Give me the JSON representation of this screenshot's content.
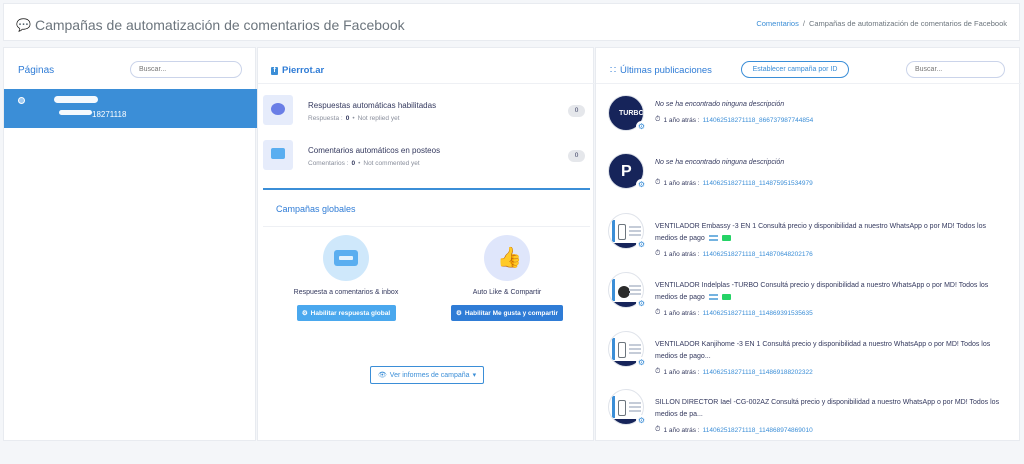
{
  "header": {
    "title": "Campañas de automatización de comentarios de Facebook",
    "title_icon": "comments-icon",
    "breadcrumb": [
      "Comentarios",
      "/",
      "Campañas de automatización de comentarios de Facebook"
    ]
  },
  "pages_panel": {
    "title": "Páginas",
    "search_placeholder": "Buscar...",
    "items": [
      {
        "id_suffix": "18271118",
        "selected": true
      }
    ]
  },
  "page_panel": {
    "page_name": "Pierrot.ar",
    "features": [
      {
        "title": "Respuestas automáticas habilitadas",
        "stat_label": "Respuesta :",
        "stat_value": "0",
        "dot": "•",
        "status": "Not replied yet",
        "count": "0"
      },
      {
        "title": "Comentarios automáticos en posteos",
        "stat_label": "Comentarios :",
        "stat_value": "0",
        "dot": "•",
        "status": "Not commented yet",
        "count": "0"
      }
    ],
    "global": {
      "title": "Campañas globales",
      "cards": [
        {
          "label": "Respuesta a comentarios & inbox",
          "button": "Habilitar respuesta global"
        },
        {
          "label": "Auto Like & Compartir",
          "button": "Habilitar Me gusta y compartir"
        }
      ]
    },
    "report_button": "Ver informes de campaña"
  },
  "posts_panel": {
    "title": "Últimas publicaciones",
    "campaign_button": "Establecer campaña por ID",
    "search_placeholder": "Buscar...",
    "time_prefix": "1 año atrás :",
    "posts": [
      {
        "desc": "No se ha encontrado ninguna descripción",
        "post_id": "114062518271118_866737987744854"
      },
      {
        "desc": "No se ha encontrado ninguna descripción",
        "post_id": "114062518271118_114875951534979"
      },
      {
        "desc": "VENTILADOR Embassy -3 EN 1 Consultá precio y disponibilidad a nuestro WhatsApp o por MD! Todos los medios de pago",
        "post_id": "114062518271118_114870648202176"
      },
      {
        "desc": "VENTILADOR Indelplas -TURBO Consultá precio y disponibilidad a nuestro WhatsApp o por MD! Todos los medios de pago",
        "post_id": "114062518271118_114869391535635"
      },
      {
        "desc": "VENTILADOR Kanjihome -3 EN 1 Consultá precio y disponibilidad a nuestro WhatsApp o por MD! Todos los medios de pago...",
        "post_id": "114062518271118_114869188202322"
      },
      {
        "desc": "SILLON DIRECTOR Iael -CG-002AZ Consultá precio y disponibilidad a nuestro WhatsApp o por MD! Todos los medios de pa...",
        "post_id": "114062518271118_114868974869010"
      }
    ]
  },
  "colors": {
    "accent": "#3b8ed7",
    "selected_row": "#3b8ed7",
    "background": "#f4f6f9"
  }
}
